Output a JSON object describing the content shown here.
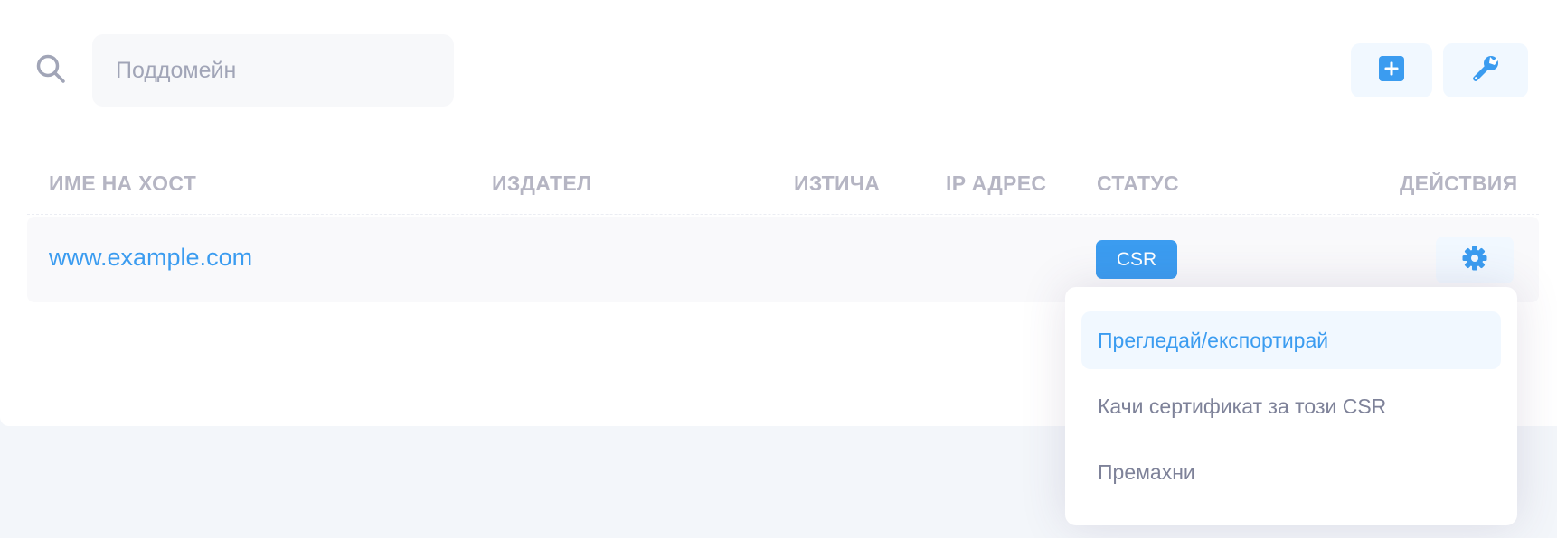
{
  "search": {
    "placeholder": "Поддомейн",
    "icon": "search-icon"
  },
  "toolbar": {
    "add_icon": "plus-square-icon",
    "tools_icon": "wrench-icon"
  },
  "table": {
    "columns": [
      "ИМЕ НА ХОСТ",
      "ИЗДАТЕЛ",
      "ИЗТИЧА",
      "IP АДРЕС",
      "СТАТУС",
      "ДЕЙСТВИЯ"
    ],
    "rows": [
      {
        "hostname": "www.example.com",
        "issuer": "",
        "expires": "",
        "ip": "",
        "status": "CSR",
        "action_icon": "gear-icon"
      }
    ]
  },
  "dropdown": {
    "items": [
      {
        "label": "Прегледай/експортирай",
        "active": true
      },
      {
        "label": "Качи сертификат за този CSR",
        "active": false
      },
      {
        "label": "Премахни",
        "active": false
      }
    ]
  },
  "colors": {
    "accent": "#3b9cf0",
    "accent_light": "#f1f8ff",
    "muted": "#b5b5c3",
    "menu_text": "#7e8299"
  }
}
